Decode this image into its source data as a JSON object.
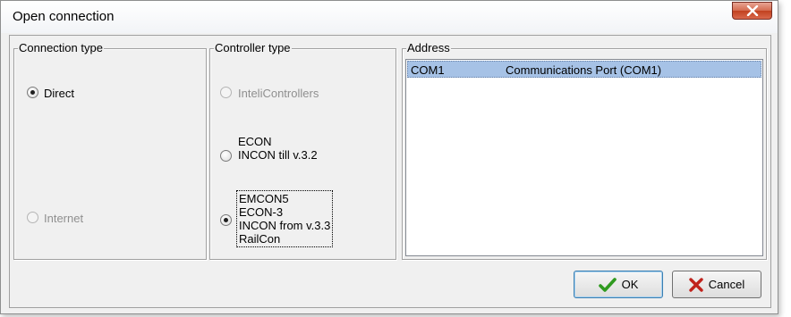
{
  "window": {
    "title": "Open connection"
  },
  "connection_type": {
    "legend": "Connection type",
    "options": [
      {
        "label": "Direct",
        "checked": true,
        "enabled": true
      },
      {
        "label": "Internet",
        "checked": false,
        "enabled": false
      }
    ]
  },
  "controller_type": {
    "legend": "Controller type",
    "options": [
      {
        "lines": [
          "InteliControllers"
        ],
        "checked": false,
        "enabled": false
      },
      {
        "lines": [
          "ECON",
          "INCON till v.3.2"
        ],
        "checked": false,
        "enabled": true
      },
      {
        "lines": [
          "EMCON5",
          "ECON-3",
          "INCON from v.3.3",
          "RailCon"
        ],
        "checked": true,
        "enabled": true
      }
    ]
  },
  "address": {
    "legend": "Address",
    "rows": [
      {
        "port": "COM1",
        "description": "Communications Port (COM1)",
        "selected": true
      }
    ]
  },
  "buttons": {
    "ok": {
      "label": "OK",
      "icon": "checkmark-icon",
      "color": "#2f9a1f"
    },
    "cancel": {
      "label": "Cancel",
      "icon": "x-icon",
      "color": "#c0221c"
    }
  }
}
